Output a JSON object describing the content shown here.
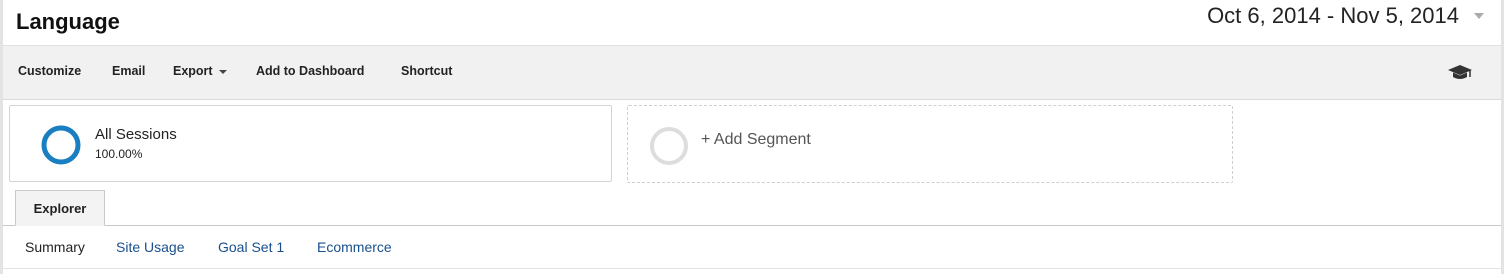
{
  "header": {
    "title": "Language",
    "date_range": "Oct 6, 2014 - Nov 5, 2014",
    "date_dropdown_icon": "triangle-down-icon"
  },
  "toolbar": {
    "items": [
      {
        "label": "Customize"
      },
      {
        "label": "Email"
      },
      {
        "label": "Export",
        "has_dropdown": true
      },
      {
        "label": "Add to Dashboard"
      },
      {
        "label": "Shortcut"
      }
    ],
    "right_icon": "graduation-cap-icon"
  },
  "segments": {
    "active": {
      "name": "All Sessions",
      "percent": "100.00%",
      "ring_color": "#1a7fc1"
    },
    "add_label": "+ Add Segment"
  },
  "tabs": {
    "main": "Explorer",
    "sub": [
      {
        "label": "Summary",
        "active": true
      },
      {
        "label": "Site Usage",
        "active": false
      },
      {
        "label": "Goal Set 1",
        "active": false
      },
      {
        "label": "Ecommerce",
        "active": false
      }
    ]
  }
}
